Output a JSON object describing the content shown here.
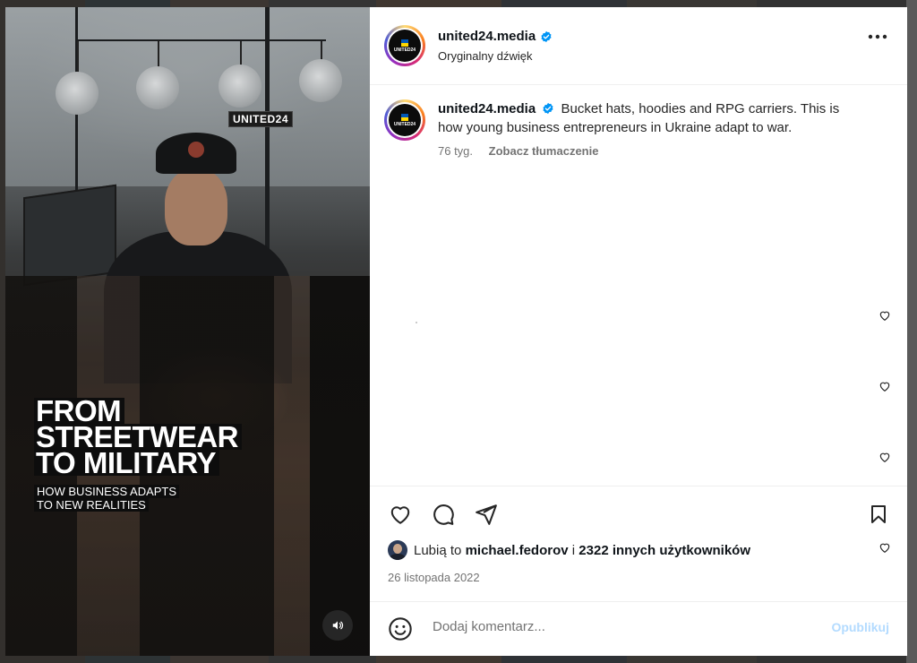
{
  "media": {
    "brand_tag": "UNITED24",
    "headline_lines": [
      "FROM",
      "STREETWEAR",
      "TO MILITARY"
    ],
    "sub_lines": [
      "HOW BUSINESS ADAPTS",
      "TO NEW REALITIES"
    ],
    "sound_icon": "speaker-icon"
  },
  "post": {
    "username": "united24.media",
    "verified": true,
    "audio": "Oryginalny dźwięk",
    "avatar_text": "UNITED24",
    "caption_user": "united24.media",
    "caption_text": "Bucket hats, hoodies and RPG carriers. This is how young business entrepreneurs in Ukraine adapt to war.",
    "caption_time": "76 tyg.",
    "translate_label": "Zobacz tłumaczenie"
  },
  "likes": {
    "prefix": "Lubią to",
    "user": "michael.fedorov",
    "connector": "i",
    "others": "2322 innych użytkowników"
  },
  "date": "26 listopada 2022",
  "comment": {
    "placeholder": "Dodaj komentarz...",
    "publish_label": "Opublikuj"
  },
  "colors": {
    "verified": "#0095f6",
    "publish_disabled": "#b3dbff",
    "flag_blue": "#0057b7",
    "flag_yellow": "#ffd700"
  }
}
